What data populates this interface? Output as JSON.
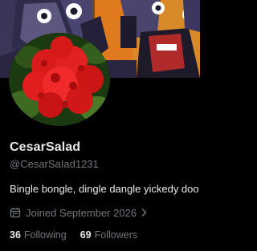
{
  "profile": {
    "display_name": "CesarSalad",
    "handle": "@CesarSaIad1231",
    "bio": "Bingle bongle, dingle dangle yickedy doo",
    "joined": "Joined September 2026",
    "following_count": "36",
    "following_label": "Following",
    "followers_count": "69",
    "followers_label": "Followers"
  },
  "icons": {
    "joined": "calendar-icon",
    "joined_arrow": "chevron-right-icon"
  },
  "colors": {
    "background": "#000000",
    "primary_text": "#e7e9ea",
    "secondary_text": "#71767b"
  }
}
